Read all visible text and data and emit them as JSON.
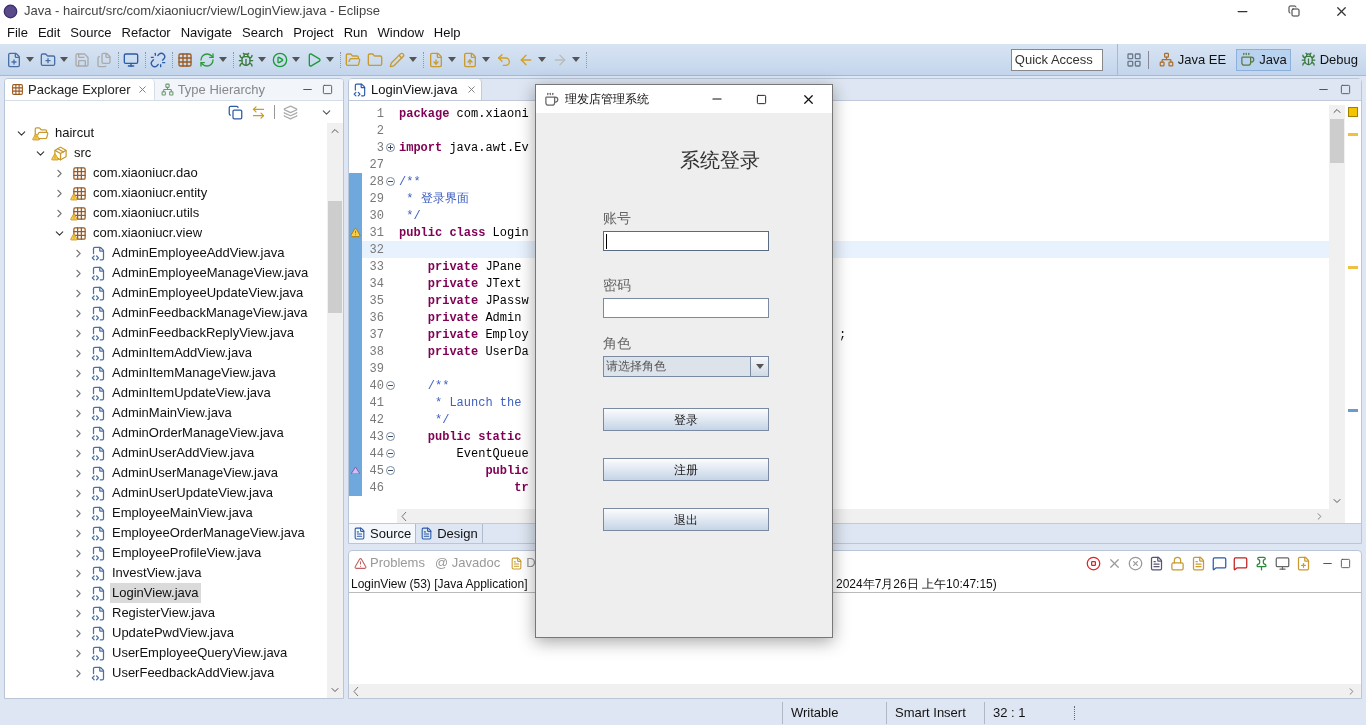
{
  "window": {
    "title": "Java - haircut/src/com/xiaoniucr/view/LoginView.java - Eclipse"
  },
  "menu": [
    "File",
    "Edit",
    "Source",
    "Refactor",
    "Navigate",
    "Search",
    "Project",
    "Run",
    "Window",
    "Help"
  ],
  "quick_access": {
    "placeholder": "Quick Access"
  },
  "perspectives": [
    {
      "label": "Java EE",
      "selected": false
    },
    {
      "label": "Java",
      "selected": true
    },
    {
      "label": "Debug",
      "selected": false
    }
  ],
  "package_explorer": {
    "tabs": [
      {
        "label": "Package Explorer",
        "selected": true
      },
      {
        "label": "Type Hierarchy",
        "selected": false
      }
    ],
    "tree": [
      {
        "label": "haircut",
        "kind": "project",
        "warning": true,
        "expanded": true,
        "selected": false,
        "children": [
          {
            "label": "src",
            "kind": "source",
            "warning": true,
            "expanded": true,
            "selected": false,
            "children": [
              {
                "label": "com.xiaoniucr.dao",
                "kind": "package",
                "warning": false,
                "expanded": false,
                "selected": false
              },
              {
                "label": "com.xiaoniucr.entity",
                "kind": "package",
                "warning": true,
                "expanded": false,
                "selected": false
              },
              {
                "label": "com.xiaoniucr.utils",
                "kind": "package",
                "warning": true,
                "expanded": false,
                "selected": false
              },
              {
                "label": "com.xiaoniucr.view",
                "kind": "package",
                "warning": true,
                "expanded": true,
                "selected": false,
                "children": [
                  {
                    "label": "AdminEmployeeAddView.java",
                    "kind": "file",
                    "warning": false,
                    "expanded": false,
                    "selected": false
                  },
                  {
                    "label": "AdminEmployeeManageView.java",
                    "kind": "file",
                    "warning": false,
                    "expanded": false,
                    "selected": false
                  },
                  {
                    "label": "AdminEmployeeUpdateView.java",
                    "kind": "file",
                    "warning": false,
                    "expanded": false,
                    "selected": false
                  },
                  {
                    "label": "AdminFeedbackManageView.java",
                    "kind": "file",
                    "warning": false,
                    "expanded": false,
                    "selected": false
                  },
                  {
                    "label": "AdminFeedbackReplyView.java",
                    "kind": "file",
                    "warning": false,
                    "expanded": false,
                    "selected": false
                  },
                  {
                    "label": "AdminItemAddView.java",
                    "kind": "file",
                    "warning": false,
                    "expanded": false,
                    "selected": false
                  },
                  {
                    "label": "AdminItemManageView.java",
                    "kind": "file",
                    "warning": false,
                    "expanded": false,
                    "selected": false
                  },
                  {
                    "label": "AdminItemUpdateView.java",
                    "kind": "file",
                    "warning": false,
                    "expanded": false,
                    "selected": false
                  },
                  {
                    "label": "AdminMainView.java",
                    "kind": "file",
                    "warning": false,
                    "expanded": false,
                    "selected": false
                  },
                  {
                    "label": "AdminOrderManageView.java",
                    "kind": "file",
                    "warning": false,
                    "expanded": false,
                    "selected": false
                  },
                  {
                    "label": "AdminUserAddView.java",
                    "kind": "file",
                    "warning": false,
                    "expanded": false,
                    "selected": false
                  },
                  {
                    "label": "AdminUserManageView.java",
                    "kind": "file",
                    "warning": false,
                    "expanded": false,
                    "selected": false
                  },
                  {
                    "label": "AdminUserUpdateView.java",
                    "kind": "file",
                    "warning": false,
                    "expanded": false,
                    "selected": false
                  },
                  {
                    "label": "EmployeeMainView.java",
                    "kind": "file",
                    "warning": false,
                    "expanded": false,
                    "selected": false
                  },
                  {
                    "label": "EmployeeOrderManageView.java",
                    "kind": "file",
                    "warning": false,
                    "expanded": false,
                    "selected": false
                  },
                  {
                    "label": "EmployeeProfileView.java",
                    "kind": "file",
                    "warning": false,
                    "expanded": false,
                    "selected": false
                  },
                  {
                    "label": "InvestView.java",
                    "kind": "file",
                    "warning": false,
                    "expanded": false,
                    "selected": false
                  },
                  {
                    "label": "LoginView.java",
                    "kind": "file",
                    "warning": false,
                    "expanded": false,
                    "selected": true
                  },
                  {
                    "label": "RegisterView.java",
                    "kind": "file",
                    "warning": false,
                    "expanded": false,
                    "selected": false
                  },
                  {
                    "label": "UpdatePwdView.java",
                    "kind": "file",
                    "warning": false,
                    "expanded": false,
                    "selected": false
                  },
                  {
                    "label": "UserEmployeeQueryView.java",
                    "kind": "file",
                    "warning": false,
                    "expanded": false,
                    "selected": false
                  },
                  {
                    "label": "UserFeedbackAddView.java",
                    "kind": "file",
                    "warning": false,
                    "expanded": false,
                    "selected": false
                  }
                ]
              }
            ]
          }
        ]
      }
    ]
  },
  "editor": {
    "tabs": [
      {
        "label": "LoginView.java",
        "selected": true
      }
    ],
    "lines": [
      {
        "number": "1",
        "changed": false,
        "current": false,
        "tokens": [
          {
            "kind": "keyword",
            "t": "package"
          },
          {
            "kind": "plain",
            "t": " com.xiaoni"
          }
        ]
      },
      {
        "number": "2",
        "changed": false,
        "current": false
      },
      {
        "number": "3",
        "folded": true,
        "changed": false,
        "current": false,
        "tokens": [
          {
            "kind": "keyword",
            "t": "import"
          },
          {
            "kind": "plain",
            "t": " java.awt.Ev"
          }
        ]
      },
      {
        "number": "27",
        "changed": false,
        "current": false
      },
      {
        "number": "28",
        "folded": false,
        "changed": true,
        "current": false,
        "tokens": [
          {
            "kind": "doc",
            "t": "/**"
          }
        ]
      },
      {
        "number": "29",
        "changed": true,
        "current": false,
        "tokens": [
          {
            "kind": "doc",
            "t": " * 登录界面"
          }
        ]
      },
      {
        "number": "30",
        "changed": true,
        "current": false,
        "tokens": [
          {
            "kind": "doc",
            "t": " */"
          }
        ]
      },
      {
        "number": "31",
        "annotation": {
          "kind": "warning"
        },
        "changed": true,
        "current": false,
        "tokens": [
          {
            "kind": "keyword",
            "t": "public class"
          },
          {
            "kind": "plain",
            "t": " Login"
          }
        ]
      },
      {
        "number": "32",
        "changed": true,
        "current": true
      },
      {
        "number": "33",
        "changed": true,
        "current": false,
        "tokens": [
          {
            "kind": "keyword",
            "t": "    private"
          },
          {
            "kind": "plain",
            "t": " JPane"
          }
        ]
      },
      {
        "number": "34",
        "changed": true,
        "current": false,
        "tokens": [
          {
            "kind": "keyword",
            "t": "    private"
          },
          {
            "kind": "plain",
            "t": " JText"
          }
        ]
      },
      {
        "number": "35",
        "changed": true,
        "current": false,
        "tokens": [
          {
            "kind": "keyword",
            "t": "    private"
          },
          {
            "kind": "plain",
            "t": " JPassw"
          }
        ]
      },
      {
        "number": "36",
        "changed": true,
        "current": false,
        "tokens": [
          {
            "kind": "keyword",
            "t": "    private"
          },
          {
            "kind": "plain",
            "t": " Admin"
          }
        ]
      },
      {
        "number": "37",
        "changed": true,
        "current": false,
        "tokens": [
          {
            "kind": "keyword",
            "t": "    private"
          },
          {
            "kind": "plain",
            "t": " Employ"
          }
        ],
        "tail": ";"
      },
      {
        "number": "38",
        "changed": true,
        "current": false,
        "tokens": [
          {
            "kind": "keyword",
            "t": "    private"
          },
          {
            "kind": "plain",
            "t": " UserDa"
          }
        ]
      },
      {
        "number": "39",
        "changed": true,
        "current": false
      },
      {
        "number": "40",
        "folded": false,
        "changed": true,
        "current": false,
        "tokens": [
          {
            "kind": "doc",
            "t": "    /**"
          }
        ]
      },
      {
        "number": "41",
        "changed": true,
        "current": false,
        "tokens": [
          {
            "kind": "doc",
            "t": "     * Launch the"
          }
        ]
      },
      {
        "number": "42",
        "changed": true,
        "current": false,
        "tokens": [
          {
            "kind": "doc",
            "t": "     */"
          }
        ]
      },
      {
        "number": "43",
        "folded": false,
        "changed": true,
        "current": false,
        "tokens": [
          {
            "kind": "keyword",
            "t": "    public static"
          }
        ]
      },
      {
        "number": "44",
        "folded": false,
        "changed": true,
        "current": false,
        "tokens": [
          {
            "kind": "plain",
            "t": "        EventQueue"
          }
        ]
      },
      {
        "number": "45",
        "folded": false,
        "annotation": {
          "kind": "override"
        },
        "changed": true,
        "current": false,
        "tokens": [
          {
            "kind": "keyword",
            "t": "            public"
          }
        ]
      },
      {
        "number": "46",
        "changed": true,
        "current": false,
        "tokens": [
          {
            "kind": "keyword",
            "t": "                tr"
          }
        ]
      }
    ],
    "bottom_tabs": [
      {
        "label": "Source",
        "selected": true
      },
      {
        "label": "Design",
        "selected": false
      }
    ]
  },
  "console": {
    "tabs": [
      {
        "label": "Problems",
        "selected": false
      },
      {
        "label": "@ Javadoc",
        "selected": false
      },
      {
        "label": "D",
        "selected": false
      }
    ],
    "header_left": "LoginView (53) [Java Application]",
    "header_right": "2024年7月26日 上午10:47:15)"
  },
  "dialog": {
    "title": "理发店管理系统",
    "heading": "系统登录",
    "fields": [
      {
        "kind": "text",
        "label": "账号",
        "focused": true
      },
      {
        "kind": "password",
        "label": "密码",
        "focused": false
      },
      {
        "kind": "select",
        "label": "角色",
        "placeholder": "请选择角色"
      }
    ],
    "buttons": [
      "登录",
      "注册",
      "退出"
    ]
  },
  "status_bar": [
    "Writable",
    "Smart Insert",
    "32 : 1"
  ]
}
